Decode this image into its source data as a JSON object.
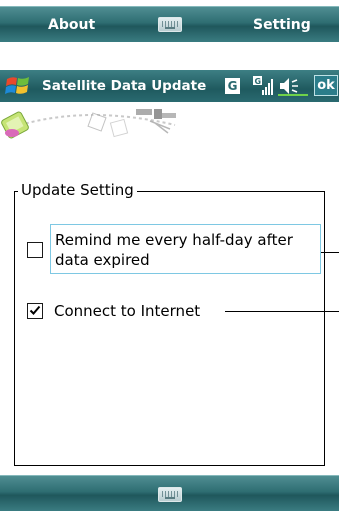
{
  "top_menu": {
    "left_softkey": "About",
    "right_softkey": "Setting",
    "keyboard_icon": "keyboard-icon"
  },
  "title_bar": {
    "title": "Satellite Data Update",
    "start_icon": "windows-start-icon",
    "status_g": "G",
    "signal_icon": "signal-icon",
    "volume_icon": "speaker-icon",
    "ok_label": "ok"
  },
  "group": {
    "title": "Update Setting",
    "options": [
      {
        "label": "Remind me every half-day after data expired",
        "checked": false
      },
      {
        "label": "Connect to Internet",
        "checked": true
      }
    ]
  },
  "bottom_menu": {
    "keyboard_icon": "keyboard-icon"
  },
  "colors": {
    "bar": "#2e6d72",
    "ok_bg": "#2b7d8a",
    "focus_border": "#7ec8e3"
  }
}
